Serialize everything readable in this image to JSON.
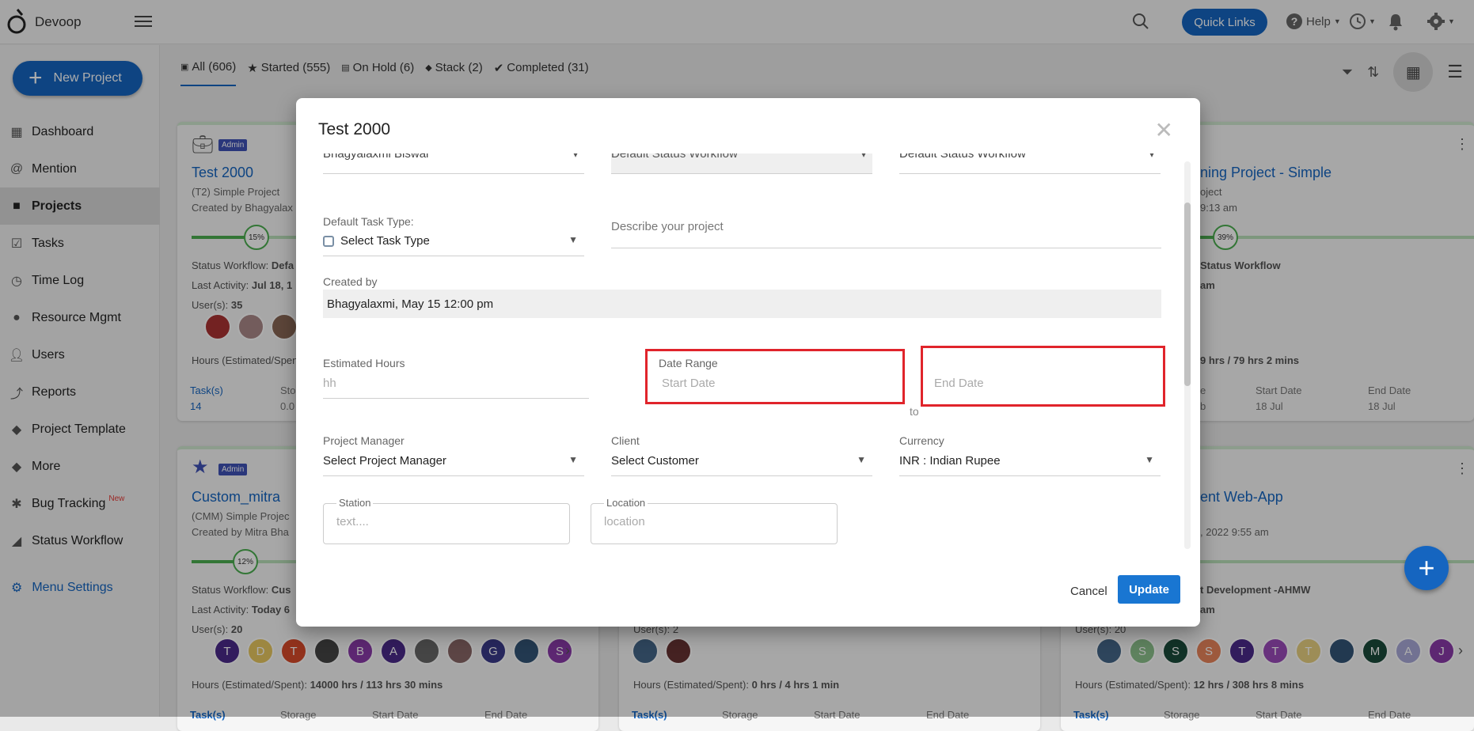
{
  "app": {
    "name": "Devoop"
  },
  "header": {
    "quick_links": "Quick Links",
    "help": "Help"
  },
  "sidebar": {
    "new_project": "New Project",
    "items": [
      {
        "label": "Dashboard"
      },
      {
        "label": "Mention"
      },
      {
        "label": "Projects"
      },
      {
        "label": "Tasks"
      },
      {
        "label": "Time Log"
      },
      {
        "label": "Resource Mgmt"
      },
      {
        "label": "Users"
      },
      {
        "label": "Reports"
      },
      {
        "label": "Project Template"
      },
      {
        "label": "More"
      },
      {
        "label": "Bug Tracking",
        "badge": "New"
      },
      {
        "label": "Status Workflow"
      }
    ],
    "menu_settings": "Menu Settings"
  },
  "tabs": [
    {
      "label": "All (606)"
    },
    {
      "label": "Started (555)"
    },
    {
      "label": "On Hold (6)"
    },
    {
      "label": "Stack (2)"
    },
    {
      "label": "Completed (31)"
    }
  ],
  "cards": {
    "c1": {
      "badge": "Admin",
      "title": "Test 2000",
      "type": "(T2) Simple Project",
      "created": "Created by Bhagyalax",
      "pct": "15%",
      "pct_value": 15,
      "workflow_label": "Status Workflow:",
      "workflow_val": "Defa",
      "activity_label": "Last Activity:",
      "activity_val": "Jul 18, 1",
      "users_label": "User(s):",
      "users_val": "35",
      "hours_label": "Hours (Estimated/Spen",
      "col1": "Task(s)",
      "col1v": "14",
      "col2": "Sto",
      "col2v": "0.0"
    },
    "c2": {
      "badge": "Admin",
      "title": "Custom_mitra",
      "type": "(CMM) Simple Projec",
      "created": "Created by Mitra Bha",
      "pct": "12%",
      "pct_value": 12,
      "workflow_label": "Status Workflow:",
      "workflow_val": "Cus",
      "activity_label": "Last Activity:",
      "activity_val": "Today 6",
      "users_label": "User(s):",
      "users_val": "20",
      "hours": "Hours (Estimated/Spent):",
      "hours_val": "14000 hrs / 113 hrs 30 mins",
      "col1": "Task(s)",
      "col2": "Storage",
      "col3": "Start Date",
      "col4": "End Date",
      "avatars": [
        "T",
        "D",
        "T",
        "",
        "B",
        "A",
        "",
        "",
        "G",
        "",
        "S"
      ]
    },
    "c3": {
      "title": "ning Project - Simple",
      "type": "oject",
      "created": "9:13 am",
      "pct": "39%",
      "pct_value": 39,
      "workflow": "Status Workflow",
      "activity": "am",
      "hours_val": "9 hrs / 79 hrs 2 mins",
      "col1": "e",
      "col1v": "b",
      "col3": "Start Date",
      "col3v": "18 Jul",
      "col4": "End Date",
      "col4v": "18 Jul"
    },
    "c4": {
      "users": "User(s): 2",
      "hours": "Hours (Estimated/Spent):",
      "hours_val": "0 hrs / 4 hrs 1 min",
      "col1": "Task(s)",
      "col2": "Storage",
      "col3": "Start Date",
      "col4": "End Date"
    },
    "c5": {
      "title": "ent Web-App",
      "created": ", 2022 9:55 am",
      "workflow": "t Development -AHMW",
      "activity": "am",
      "users": "User(s): 20",
      "hours": "Hours (Estimated/Spent):",
      "hours_val": "12 hrs / 308 hrs 8 mins",
      "col1": "Task(s)",
      "col2": "Storage",
      "col3": "Start Date",
      "col4": "End Date",
      "avatars": [
        "",
        "S",
        "S",
        "S",
        "T",
        "T",
        "T",
        "",
        "M",
        "A",
        "J"
      ]
    }
  },
  "modal": {
    "title": "Test 2000",
    "top_field1": "Bhagyalaxmi Biswal",
    "top_field2": "Default Status Workflow",
    "top_field3": "Default Status Workflow",
    "task_type_label": "Default Task Type:",
    "task_type_value": "Select Task Type",
    "describe_placeholder": "Describe your project",
    "created_by_label": "Created by",
    "created_by_value": "Bhagyalaxmi, May 15 12:00 pm",
    "est_hours_label": "Estimated Hours",
    "est_hours_placeholder": "hh",
    "date_range_label": "Date Range",
    "start_placeholder": "Start Date",
    "end_placeholder": "End Date",
    "to": "to",
    "pm_label": "Project Manager",
    "pm_value": "Select Project Manager",
    "client_label": "Client",
    "client_value": "Select Customer",
    "currency_label": "Currency",
    "currency_value": "INR : Indian Rupee",
    "station_label": "Station",
    "station_placeholder": "text....",
    "location_label": "Location",
    "location_placeholder": "location",
    "cancel": "Cancel",
    "update": "Update"
  },
  "colors": {
    "primary": "#1565c0",
    "highlight": "#e0242b",
    "progress": "#4caf50"
  }
}
